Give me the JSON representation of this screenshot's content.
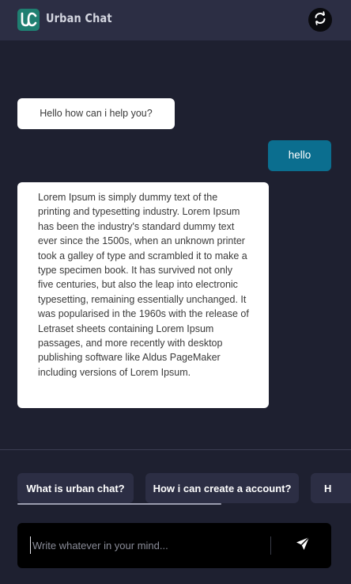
{
  "header": {
    "title": "Urban Chat",
    "logo_text": "UC",
    "logo_icon": "uc-logo-icon",
    "refresh_icon": "refresh-icon"
  },
  "messages": [
    {
      "from": "bot",
      "text": "Hello how can i help you?"
    },
    {
      "from": "user",
      "text": "hello"
    },
    {
      "from": "bot",
      "text": "Lorem Ipsum is simply dummy text of the printing and typesetting industry. Lorem Ipsum has been the industry's standard dummy text ever since the 1500s, when an unknown printer took a galley of type and scrambled it to make a type specimen book. It has survived not only five centuries, but also the leap into electronic typesetting, remaining essentially unchanged. It was popularised in the 1960s with the release of Letraset sheets containing Lorem Ipsum passages, and more recently with desktop publishing software like Aldus PageMaker including versions of Lorem Ipsum."
    }
  ],
  "suggestions": [
    {
      "label": "What is urban chat?"
    },
    {
      "label": "How i can create a account?"
    },
    {
      "label": "H"
    }
  ],
  "composer": {
    "placeholder": "Write whatever in your mind...",
    "value": "",
    "send_icon": "send-icon"
  },
  "colors": {
    "background": "#1e2030",
    "header": "#2c2e44",
    "accent": "#1f7f71",
    "user_bubble": "#0b6e8f",
    "bot_bubble": "#ffffff",
    "composer": "#000000"
  }
}
